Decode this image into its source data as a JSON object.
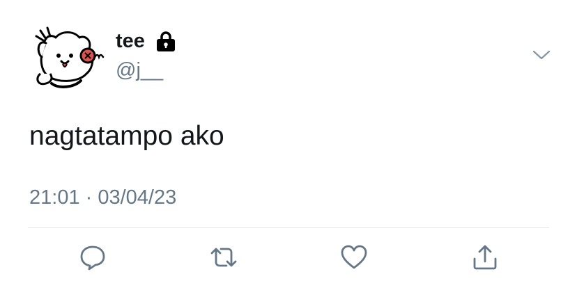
{
  "tweet": {
    "display_name": "tee",
    "handle": "@j__",
    "protected": true,
    "text": "nagtatampo ako",
    "timestamp": "21:01 · 03/04/23"
  },
  "icons": {
    "lock": "lock-icon",
    "more": "chevron-down-icon",
    "reply": "reply-icon",
    "retweet": "retweet-icon",
    "like": "heart-icon",
    "share": "share-icon"
  },
  "colors": {
    "text_primary": "#14171a",
    "text_secondary": "#657786",
    "icon": "#657786",
    "divider": "#e1e8ed",
    "background": "#ffffff"
  }
}
